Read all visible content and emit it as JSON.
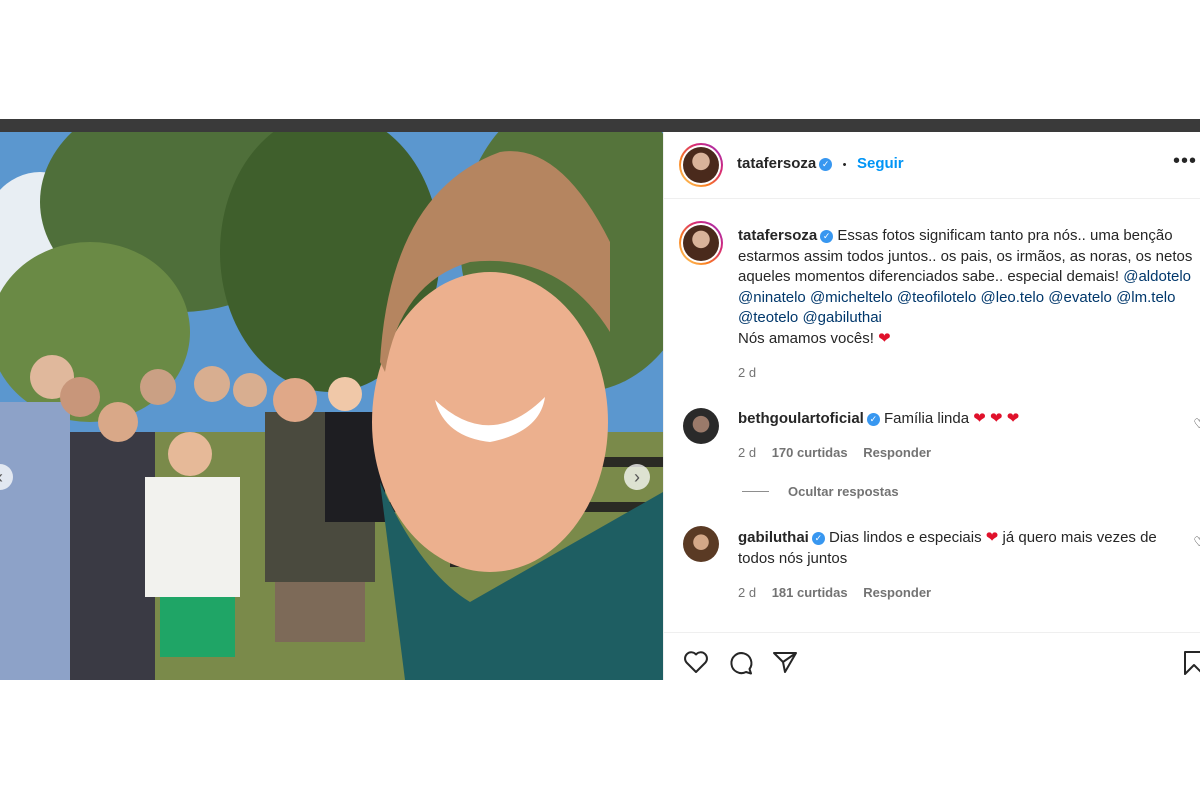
{
  "post": {
    "username": "tatafersoza",
    "follow_label": "Seguir",
    "separator": "•",
    "more": "•••",
    "caption": {
      "text1": "Essas fotos significam tanto pra nós.. uma benção",
      "text2": "estarmos assim todos juntos.. os pais, os irmãos, as noras, os netos",
      "text3": "aqueles momentos diferenciados sabe.. especial demais!",
      "mentions": [
        "@aldotelo",
        "@ninatelo",
        "@micheltelo",
        "@teofilotelo",
        "@leo.telo",
        "@evatelo",
        "@lm.telo",
        "@teotelo",
        "@gabiluthai"
      ],
      "closing": "Nós amamos vocês!",
      "time": "2 d"
    },
    "comments": [
      {
        "username": "bethgoulartoficial",
        "text": "Família linda",
        "hearts": "❤ ❤ ❤",
        "time": "2 d",
        "likes": "170 curtidas",
        "reply": "Responder",
        "hide_replies": "Ocultar respostas"
      },
      {
        "username": "gabiluthai",
        "text1": "Dias lindos e especiais",
        "text2": "já quero mais vezes de",
        "text3": "todos nós juntos",
        "time": "2 d",
        "likes": "181 curtidas",
        "reply": "Responder"
      }
    ]
  },
  "icons": [
    "like-icon",
    "comment-icon",
    "share-icon",
    "save-icon",
    "verified-icon",
    "next-arrow-icon",
    "prev-arrow-icon",
    "more-icon"
  ],
  "colors": {
    "link": "#0095f6",
    "mention": "#00376b",
    "heart": "#e0112b",
    "verified": "#3897f0",
    "meta": "#737373"
  }
}
